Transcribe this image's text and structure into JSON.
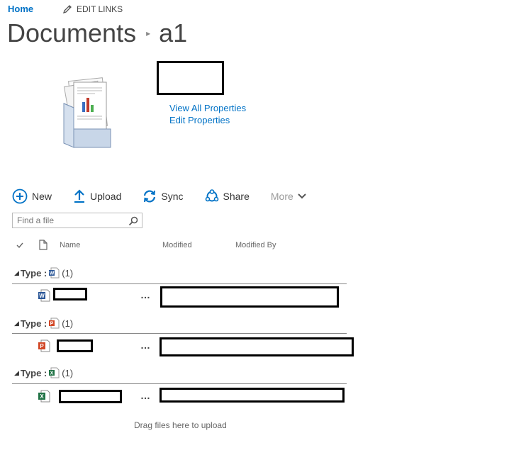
{
  "nav": {
    "home": "Home",
    "edit_links": "EDIT LINKS"
  },
  "title": {
    "library": "Documents",
    "folder": "a1"
  },
  "properties": {
    "view_all": "View All Properties",
    "edit": "Edit Properties"
  },
  "toolbar": {
    "new": "New",
    "upload": "Upload",
    "sync": "Sync",
    "share": "Share",
    "more": "More"
  },
  "search": {
    "placeholder": "Find a file"
  },
  "columns": {
    "name": "Name",
    "modified": "Modified",
    "modified_by": "Modified By"
  },
  "groups": [
    {
      "label": "Type :",
      "count": "(1)",
      "file_type": "word"
    },
    {
      "label": "Type :",
      "count": "(1)",
      "file_type": "powerpoint"
    },
    {
      "label": "Type :",
      "count": "(1)",
      "file_type": "excel"
    }
  ],
  "row_menu": "…",
  "drop_hint": "Drag files here to upload",
  "colors": {
    "link": "#0072c6",
    "word": "#2b5797",
    "powerpoint": "#d24726",
    "excel": "#217346"
  }
}
